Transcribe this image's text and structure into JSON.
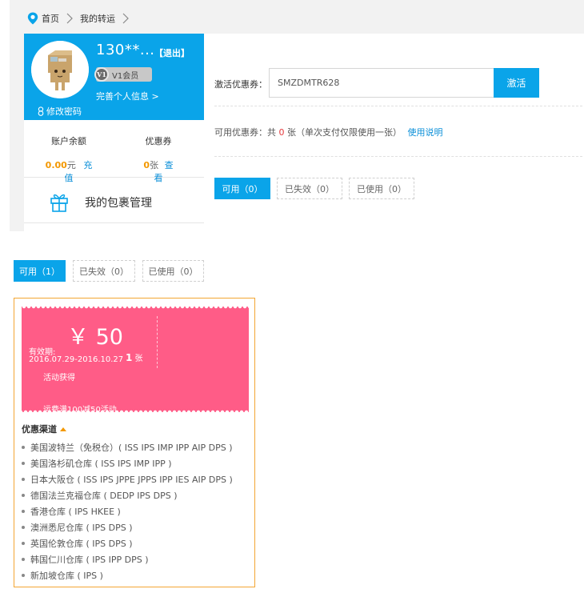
{
  "breadcrumb": {
    "home": "首页",
    "current": "我的转运"
  },
  "user": {
    "name": "130**...",
    "logout": "【退出】",
    "vip_icon": "V1",
    "vip_label": "V1会员",
    "complete_info": "完善个人信息 >",
    "change_password": "修改密码"
  },
  "balance": {
    "label": "账户余额",
    "amount": "0.00",
    "unit": "元",
    "action": "充值"
  },
  "coupons_summary": {
    "label": "优惠券",
    "count": "0",
    "unit": "张",
    "action": "查看"
  },
  "package_mgmt": "我的包裹管理",
  "activate": {
    "label": "激活优惠券：",
    "input_value": "SMZDMTR628",
    "button": "激活"
  },
  "available_info": {
    "prefix": "可用优惠券：共",
    "count": "0",
    "suffix": "张（单次支付仅限使用一张）",
    "link": "使用说明"
  },
  "tabs_top": [
    {
      "label": "可用（0）"
    },
    {
      "label": "已失效（0）"
    },
    {
      "label": "已使用（0）"
    }
  ],
  "tabs_bottom": [
    {
      "label": "可用（1）"
    },
    {
      "label": "已失效（0）"
    },
    {
      "label": "已使用（0）"
    }
  ],
  "coupon": {
    "amount": "￥ 50",
    "validity_label": "有效期:",
    "validity_dates": "2016.07.29-2016.10.27",
    "count_num": "1",
    "count_unit": "张",
    "source": "活动获得",
    "promo": "运费满100减50活动"
  },
  "channels": {
    "title": "优惠渠道",
    "items": [
      "美国波特兰（免税仓）( ISS IPS IMP IPP AIP DPS )",
      "美国洛杉矶仓库 ( ISS IPS IMP IPP )",
      "日本大阪仓 ( ISS IPS JPPE JPPS IPP IES AIP DPS )",
      "德国法兰克福仓库 ( DEDP IPS DPS )",
      "香港仓库 ( IPS HKEE )",
      "澳洲悉尼仓库 ( IPS DPS )",
      "英国伦敦仓库 ( IPS DPS )",
      "韩国仁川仓库 ( IPS IPP DPS )",
      "新加坡仓库 ( IPS )"
    ]
  },
  "colors": {
    "primary": "#0aa4e9",
    "coupon": "#ff5c87",
    "accent": "#f39800",
    "border": "#f3a633"
  }
}
